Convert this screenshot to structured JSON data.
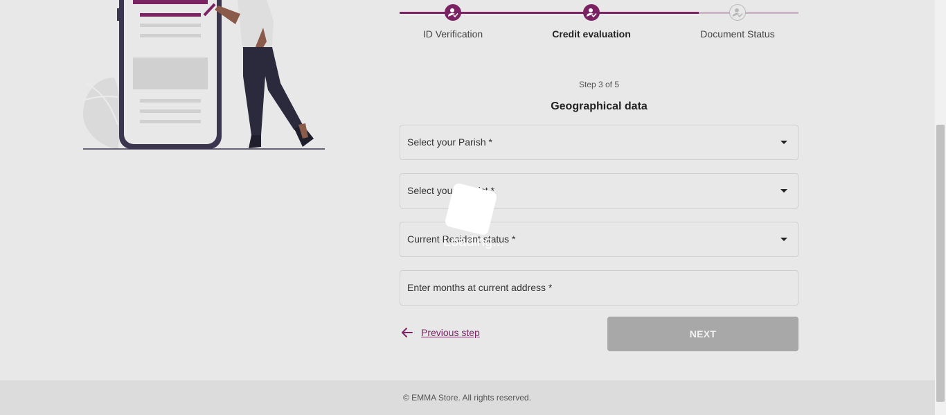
{
  "stepper": {
    "steps": [
      {
        "label": "ID Verification",
        "state": "complete"
      },
      {
        "label": "Credit evaluation",
        "state": "current"
      },
      {
        "label": "Document Status",
        "state": "pending"
      }
    ]
  },
  "form": {
    "step_count": "Step 3 of 5",
    "section_title": "Geographical data",
    "parish_label": "Select your Parish *",
    "district_label": "Select your District *",
    "resident_label": "Current Resident status *",
    "months_label": "Enter months at current address *"
  },
  "nav": {
    "previous_label": "Previous step",
    "next_label": "NEXT"
  },
  "overlay": {
    "loading_text": "Loading..."
  },
  "footer": {
    "copyright": "© EMMA Store. All rights reserved."
  },
  "colors": {
    "accent": "#7b2263",
    "disabled_button": "#a8a8a8",
    "background": "#e8e8e8"
  },
  "icons": {
    "step_icon": "person-check-icon",
    "back_icon": "arrow-left-icon",
    "dropdown_icon": "caret-down-icon"
  }
}
